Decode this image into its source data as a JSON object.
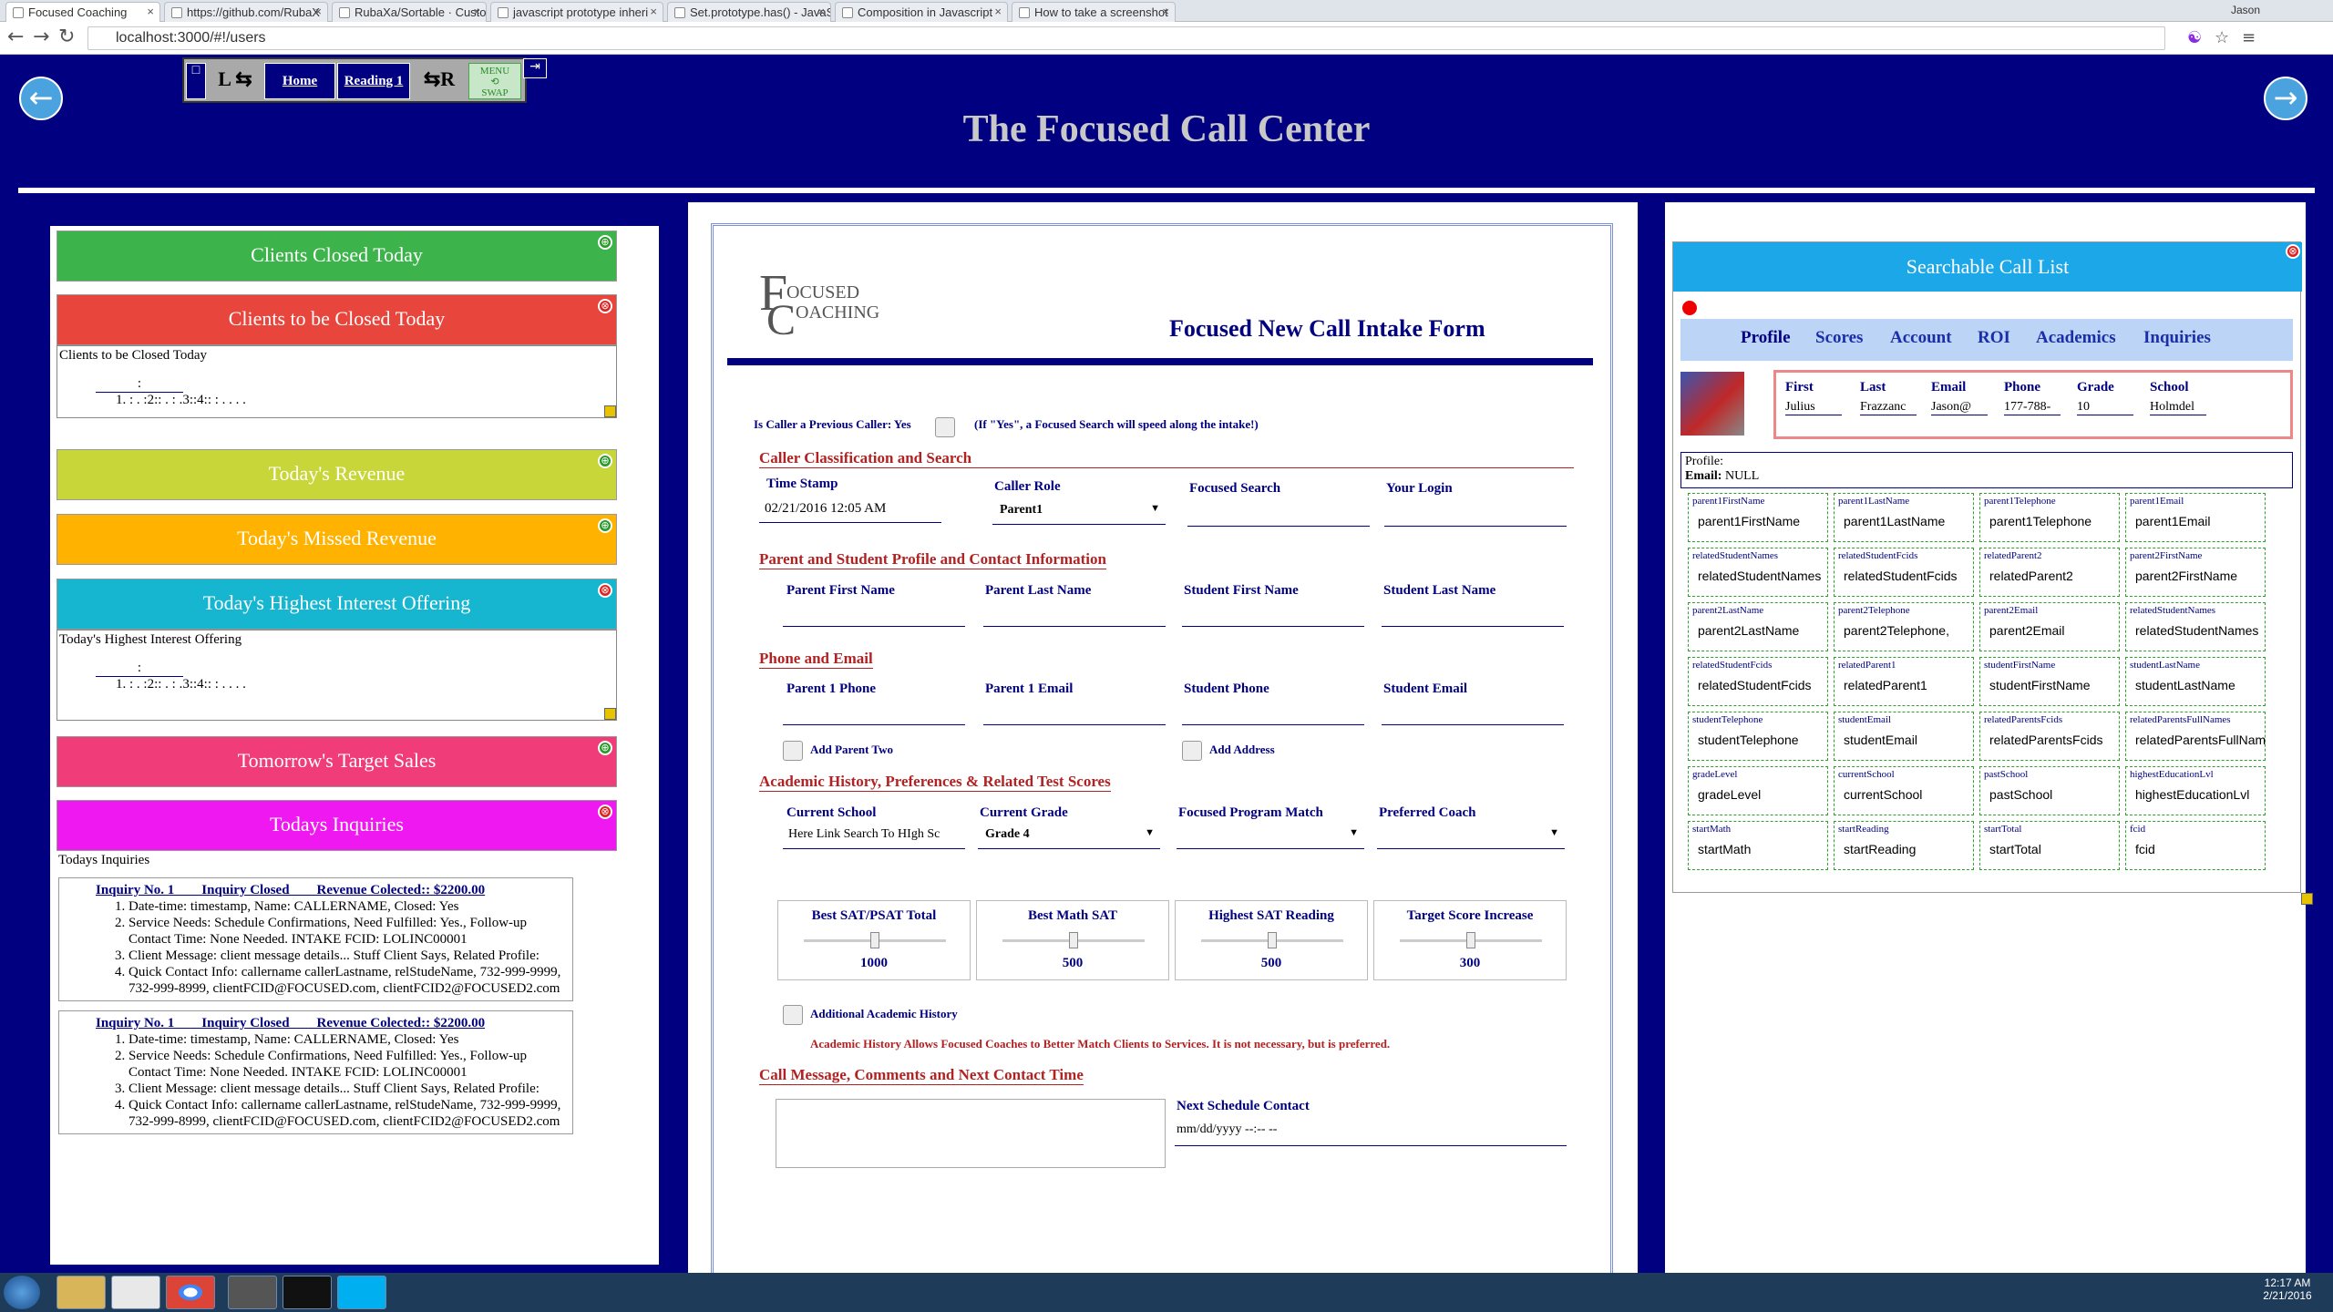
{
  "browser": {
    "tabs": [
      {
        "label": "Focused Coaching"
      },
      {
        "label": "https://github.com/RubaX"
      },
      {
        "label": "RubaXa/Sortable · Custom"
      },
      {
        "label": "javascript prototype inheri"
      },
      {
        "label": "Set.prototype.has() - JavaS"
      },
      {
        "label": "Composition in Javascript"
      },
      {
        "label": "How to take a screenshot"
      }
    ],
    "url": "localhost:3000/#!/users",
    "user_label": "Jason"
  },
  "topnav": {
    "left_label": "L",
    "home": "Home",
    "reading": "Reading 1",
    "right_label": "R",
    "menu": "MENU",
    "swap": "SWAP"
  },
  "header": {
    "title": "The Focused Call Center"
  },
  "left": {
    "cards": [
      {
        "title": "Clients Closed Today",
        "color": "#3cb44b"
      },
      {
        "title": "Clients to be Closed Today",
        "color": "#e8453c",
        "body_title": "Clients to be Closed Today",
        "dots1": ":",
        "dots2": "1. : . :2:: . : .3::4:: : . . . ."
      },
      {
        "title": "Today's Revenue",
        "color": "#c8d63a"
      },
      {
        "title": "Today's Missed Revenue",
        "color": "#ffb300"
      },
      {
        "title": "Today's Highest Interest Offering",
        "color": "#17b6d0",
        "body_title": "Today's Highest Interest Offering",
        "dots1": ":",
        "dots2": "1. : . :2:: . : .3::4:: : . . . ."
      },
      {
        "title": "Tomorrow's Target Sales",
        "color": "#f03d7a"
      },
      {
        "title": "Todays Inquiries",
        "color": "#f018f0",
        "body_title": "Todays Inquiries"
      }
    ],
    "inquiries": [
      {
        "header": "Inquiry No. 1        Inquiry Closed        Revenue Colected:: $2200.00",
        "items": [
          "Date-time: timestamp, Name: CALLERNAME, Closed: Yes",
          "Service Needs: Schedule Confirmations, Need Fulfilled: Yes., Follow-up Contact Time: None Needed. INTAKE FCID: LOLINC00001",
          "Client Message: client message details... Stuff Client Says, Related Profile:",
          "Quick Contact Info: callername callerLastname, relStudeName, 732-999-9999, 732-999-8999, clientFCID@FOCUSED.com, clientFCID2@FOCUSED2.com"
        ]
      },
      {
        "header": "Inquiry No. 1        Inquiry Closed        Revenue Colected:: $2200.00",
        "items": [
          "Date-time: timestamp, Name: CALLERNAME, Closed: Yes",
          "Service Needs: Schedule Confirmations, Need Fulfilled: Yes., Follow-up Contact Time: None Needed. INTAKE FCID: LOLINC00001",
          "Client Message: client message details... Stuff Client Says, Related Profile:",
          "Quick Contact Info: callername callerLastname, relStudeName, 732-999-9999, 732-999-8999, clientFCID@FOCUSED.com, clientFCID2@FOCUSED2.com"
        ]
      }
    ]
  },
  "form": {
    "logo_line1": "OCUSED",
    "logo_line2": "OACHING",
    "title": "Focused New Call Intake Form",
    "prev_caller": "Is Caller a Previous Caller: Yes",
    "prev_caller_note": "(If \"Yes\", a Focused Search will speed along the intake!)",
    "sec1": "Caller Classification and Search",
    "timestamp_label": "Time Stamp",
    "timestamp_value": "02/21/2016 12:05 AM",
    "role_label": "Caller Role",
    "role_value": "Parent1",
    "search_label": "Focused Search",
    "login_label": "Your Login",
    "sec2": "Parent and Student Profile and Contact Information",
    "pfn": "Parent First Name",
    "pln": "Parent Last Name",
    "sfn": "Student First Name",
    "sln": "Student Last Name",
    "sec3": "Phone and Email",
    "p1phone": "Parent 1 Phone",
    "p1email": "Parent 1 Email",
    "sphone": "Student Phone",
    "semail": "Student Email",
    "add_parent": "Add Parent Two",
    "add_address": "Add Address",
    "sec4": "Academic History, Preferences & Related Test Scores",
    "school_label": "Current School",
    "school_value": "Here Link Search To HIgh Sc",
    "grade_label": "Current Grade",
    "grade_value": "Grade 4",
    "match_label": "Focused Program Match",
    "coach_label": "Preferred Coach",
    "sliders": [
      {
        "label": "Best SAT/PSAT Total",
        "value": "1000",
        "pos": 0.5
      },
      {
        "label": "Best Math SAT",
        "value": "500",
        "pos": 0.5
      },
      {
        "label": "Highest SAT Reading",
        "value": "500",
        "pos": 0.5
      },
      {
        "label": "Target Score Increase",
        "value": "300",
        "pos": 0.5
      }
    ],
    "add_history": "Additional Academic History",
    "history_note": "Academic History Allows Focused Coaches to Better Match Clients to Services. It is not necessary, but is preferred.",
    "sec5": "Call Message, Comments and Next Contact Time",
    "next_label": "Next Schedule Contact",
    "next_value": "mm/dd/yyyy --:-- --"
  },
  "calllist": {
    "title": "Searchable Call List",
    "tabs": [
      "Profile",
      "Scores",
      "Account",
      "ROI",
      "Academics",
      "Inquiries"
    ],
    "columns": [
      "First",
      "Last",
      "Email",
      "Phone",
      "Grade",
      "School"
    ],
    "row": [
      "Julius",
      "Frazzanc",
      "Jason@",
      "177-788-",
      "10",
      "Holmdel"
    ],
    "profile_label": "Profile:",
    "email_label": "Email:",
    "email_value": "NULL",
    "fields": [
      [
        "parent1FirstName",
        "parent1FirstName"
      ],
      [
        "parent1LastName",
        "parent1LastName"
      ],
      [
        "parent1Telephone",
        "parent1Telephone"
      ],
      [
        "parent1Email",
        "parent1Email"
      ],
      [
        "relatedStudentNames",
        "relatedStudentNames"
      ],
      [
        "relatedStudentFcids",
        "relatedStudentFcids"
      ],
      [
        "relatedParent2",
        "relatedParent2"
      ],
      [
        "parent2FirstName",
        "parent2FirstName"
      ],
      [
        "parent2LastName",
        "parent2LastName"
      ],
      [
        "parent2Telephone",
        "parent2Telephone,"
      ],
      [
        "parent2Email",
        "parent2Email"
      ],
      [
        "relatedStudentNames",
        "relatedStudentNames"
      ],
      [
        "relatedStudentFcids",
        "relatedStudentFcids"
      ],
      [
        "relatedParent1",
        "relatedParent1"
      ],
      [
        "studentFirstName",
        "studentFirstName"
      ],
      [
        "studentLastName",
        "studentLastName"
      ],
      [
        "studentTelephone",
        "studentTelephone"
      ],
      [
        "studentEmail",
        "studentEmail"
      ],
      [
        "relatedParentsFcids",
        "relatedParentsFcids"
      ],
      [
        "relatedParentsFullNames",
        "relatedParentsFullNam"
      ],
      [
        "gradeLevel",
        "gradeLevel"
      ],
      [
        "currentSchool",
        "currentSchool"
      ],
      [
        "pastSchool",
        "pastSchool"
      ],
      [
        "highestEducationLvl",
        "highestEducationLvl"
      ],
      [
        "startMath",
        "startMath"
      ],
      [
        "startReading",
        "startReading"
      ],
      [
        "startTotal",
        "startTotal"
      ],
      [
        "fcid",
        "fcid"
      ]
    ]
  },
  "taskbar": {
    "time": "12:17 AM",
    "date": "2/21/2016"
  }
}
